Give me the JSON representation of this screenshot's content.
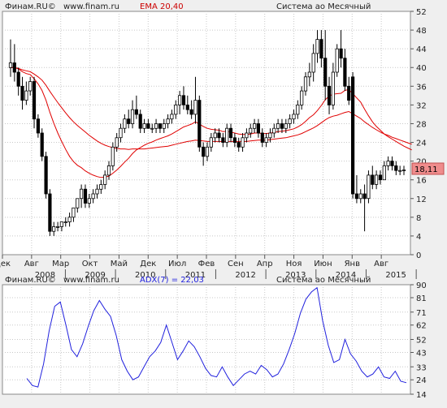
{
  "colors": {
    "page_bg": "#efefef",
    "plot_bg": "#ffffff",
    "grid": "#c8c8c8",
    "up_candle": "#ffffff",
    "down_candle": "#000000",
    "ema": "#e00000",
    "adx": "#2020dd",
    "last_label_bg": "#ef8c8c",
    "header_text": "#222222"
  },
  "header_top": {
    "source": "Финам.RU©",
    "url": "www.finam.ru",
    "indicator": "EMA 20,40",
    "timeframe": "Система ао Месячный"
  },
  "header_bottom": {
    "source": "Финам.RU©",
    "url": "www.finam.ru",
    "indicator": "ADX(7) = 22,03",
    "timeframe": "Система ао Месячный"
  },
  "price_label": "18,11",
  "month_labels": [
    "Дек",
    "Авг",
    "Мар",
    "Окт",
    "Май",
    "Дек",
    "Июл",
    "Фев",
    "Сен",
    "Апр",
    "Ноя",
    "Июн",
    "Янв",
    "Авг"
  ],
  "year_labels": [
    "2008",
    "2009",
    "2010",
    "2011",
    "2012",
    "2013",
    "2014",
    "2015"
  ],
  "chart_data": [
    {
      "type": "candlestick",
      "title": "EMA 20,40",
      "ylim": [
        0,
        52
      ],
      "yticks": [
        0,
        4,
        8,
        12,
        16,
        20,
        24,
        28,
        32,
        36,
        40,
        44,
        48,
        52
      ],
      "x_axis_months": [
        "Дек",
        "Авг",
        "Мар",
        "Окт",
        "Май",
        "Дек",
        "Июл",
        "Фев",
        "Сен",
        "Апр",
        "Ноя",
        "Июн",
        "Янв",
        "Авг"
      ],
      "x_axis_years": [
        "2008",
        "2009",
        "2010",
        "2011",
        "2012",
        "2013",
        "2014",
        "2015"
      ],
      "last_value": 18.11,
      "candles": [
        {
          "o": 40,
          "h": 46,
          "l": 38,
          "c": 41
        },
        {
          "o": 41,
          "h": 45,
          "l": 37,
          "c": 39
        },
        {
          "o": 39,
          "h": 40,
          "l": 34,
          "c": 36
        },
        {
          "o": 36,
          "h": 38,
          "l": 31,
          "c": 33
        },
        {
          "o": 33,
          "h": 37,
          "l": 32,
          "c": 35
        },
        {
          "o": 35,
          "h": 38,
          "l": 34,
          "c": 37
        },
        {
          "o": 37,
          "h": 38,
          "l": 27,
          "c": 29
        },
        {
          "o": 29,
          "h": 30,
          "l": 25,
          "c": 26
        },
        {
          "o": 26,
          "h": 27,
          "l": 20,
          "c": 21
        },
        {
          "o": 21,
          "h": 22,
          "l": 12,
          "c": 13
        },
        {
          "o": 13,
          "h": 14,
          "l": 4,
          "c": 5
        },
        {
          "o": 5,
          "h": 7,
          "l": 4,
          "c": 6
        },
        {
          "o": 6,
          "h": 7,
          "l": 5,
          "c": 6
        },
        {
          "o": 6,
          "h": 7,
          "l": 5,
          "c": 7
        },
        {
          "o": 7,
          "h": 8,
          "l": 6,
          "c": 7
        },
        {
          "o": 7,
          "h": 9,
          "l": 6,
          "c": 8
        },
        {
          "o": 8,
          "h": 10,
          "l": 7,
          "c": 10
        },
        {
          "o": 10,
          "h": 12,
          "l": 9,
          "c": 12
        },
        {
          "o": 12,
          "h": 15,
          "l": 10,
          "c": 14
        },
        {
          "o": 14,
          "h": 15,
          "l": 10,
          "c": 11
        },
        {
          "o": 11,
          "h": 13,
          "l": 10,
          "c": 12
        },
        {
          "o": 12,
          "h": 14,
          "l": 11,
          "c": 13
        },
        {
          "o": 13,
          "h": 15,
          "l": 12,
          "c": 14
        },
        {
          "o": 14,
          "h": 16,
          "l": 13,
          "c": 15
        },
        {
          "o": 15,
          "h": 18,
          "l": 14,
          "c": 17
        },
        {
          "o": 17,
          "h": 20,
          "l": 16,
          "c": 19
        },
        {
          "o": 19,
          "h": 24,
          "l": 18,
          "c": 23
        },
        {
          "o": 23,
          "h": 26,
          "l": 22,
          "c": 25
        },
        {
          "o": 25,
          "h": 28,
          "l": 24,
          "c": 27
        },
        {
          "o": 27,
          "h": 30,
          "l": 26,
          "c": 29
        },
        {
          "o": 29,
          "h": 31,
          "l": 27,
          "c": 28
        },
        {
          "o": 28,
          "h": 33,
          "l": 27,
          "c": 31
        },
        {
          "o": 31,
          "h": 34,
          "l": 29,
          "c": 30
        },
        {
          "o": 30,
          "h": 31,
          "l": 26,
          "c": 27
        },
        {
          "o": 27,
          "h": 29,
          "l": 26,
          "c": 28
        },
        {
          "o": 28,
          "h": 29,
          "l": 27,
          "c": 27
        },
        {
          "o": 27,
          "h": 28,
          "l": 26,
          "c": 27
        },
        {
          "o": 27,
          "h": 29,
          "l": 26,
          "c": 28
        },
        {
          "o": 28,
          "h": 28,
          "l": 26,
          "c": 27
        },
        {
          "o": 27,
          "h": 29,
          "l": 26,
          "c": 28
        },
        {
          "o": 28,
          "h": 30,
          "l": 27,
          "c": 29
        },
        {
          "o": 29,
          "h": 31,
          "l": 28,
          "c": 30
        },
        {
          "o": 30,
          "h": 33,
          "l": 29,
          "c": 32
        },
        {
          "o": 32,
          "h": 35,
          "l": 30,
          "c": 34
        },
        {
          "o": 34,
          "h": 36,
          "l": 31,
          "c": 32
        },
        {
          "o": 32,
          "h": 34,
          "l": 30,
          "c": 31
        },
        {
          "o": 31,
          "h": 33,
          "l": 29,
          "c": 30
        },
        {
          "o": 30,
          "h": 38,
          "l": 28,
          "c": 33
        },
        {
          "o": 33,
          "h": 34,
          "l": 22,
          "c": 23
        },
        {
          "o": 23,
          "h": 24,
          "l": 19,
          "c": 21
        },
        {
          "o": 21,
          "h": 24,
          "l": 20,
          "c": 23
        },
        {
          "o": 23,
          "h": 26,
          "l": 22,
          "c": 25
        },
        {
          "o": 25,
          "h": 27,
          "l": 24,
          "c": 26
        },
        {
          "o": 26,
          "h": 27,
          "l": 24,
          "c": 25
        },
        {
          "o": 25,
          "h": 26,
          "l": 23,
          "c": 24
        },
        {
          "o": 24,
          "h": 28,
          "l": 23,
          "c": 27
        },
        {
          "o": 27,
          "h": 28,
          "l": 24,
          "c": 25
        },
        {
          "o": 25,
          "h": 26,
          "l": 23,
          "c": 24
        },
        {
          "o": 24,
          "h": 25,
          "l": 22,
          "c": 23
        },
        {
          "o": 23,
          "h": 26,
          "l": 22,
          "c": 25
        },
        {
          "o": 25,
          "h": 27,
          "l": 24,
          "c": 26
        },
        {
          "o": 26,
          "h": 28,
          "l": 25,
          "c": 27
        },
        {
          "o": 27,
          "h": 29,
          "l": 26,
          "c": 28
        },
        {
          "o": 28,
          "h": 29,
          "l": 25,
          "c": 26
        },
        {
          "o": 26,
          "h": 27,
          "l": 23,
          "c": 24
        },
        {
          "o": 24,
          "h": 26,
          "l": 23,
          "c": 25
        },
        {
          "o": 25,
          "h": 27,
          "l": 24,
          "c": 26
        },
        {
          "o": 26,
          "h": 28,
          "l": 25,
          "c": 27
        },
        {
          "o": 27,
          "h": 29,
          "l": 26,
          "c": 28
        },
        {
          "o": 28,
          "h": 29,
          "l": 26,
          "c": 27
        },
        {
          "o": 27,
          "h": 29,
          "l": 26,
          "c": 28
        },
        {
          "o": 28,
          "h": 30,
          "l": 27,
          "c": 29
        },
        {
          "o": 29,
          "h": 31,
          "l": 28,
          "c": 30
        },
        {
          "o": 30,
          "h": 33,
          "l": 29,
          "c": 32
        },
        {
          "o": 32,
          "h": 36,
          "l": 31,
          "c": 35
        },
        {
          "o": 35,
          "h": 39,
          "l": 34,
          "c": 38
        },
        {
          "o": 38,
          "h": 41,
          "l": 36,
          "c": 39
        },
        {
          "o": 39,
          "h": 45,
          "l": 37,
          "c": 43
        },
        {
          "o": 43,
          "h": 48,
          "l": 41,
          "c": 46
        },
        {
          "o": 46,
          "h": 48,
          "l": 40,
          "c": 42
        },
        {
          "o": 42,
          "h": 48,
          "l": 33,
          "c": 36
        },
        {
          "o": 36,
          "h": 38,
          "l": 30,
          "c": 32
        },
        {
          "o": 32,
          "h": 41,
          "l": 31,
          "c": 39
        },
        {
          "o": 39,
          "h": 45,
          "l": 38,
          "c": 44
        },
        {
          "o": 44,
          "h": 48,
          "l": 40,
          "c": 42
        },
        {
          "o": 42,
          "h": 44,
          "l": 35,
          "c": 36
        },
        {
          "o": 36,
          "h": 38,
          "l": 32,
          "c": 33
        },
        {
          "o": 38,
          "h": 39,
          "l": 12,
          "c": 13
        },
        {
          "o": 13,
          "h": 17,
          "l": 11,
          "c": 12
        },
        {
          "o": 12,
          "h": 14,
          "l": 11,
          "c": 13
        },
        {
          "o": 13,
          "h": 15,
          "l": 5,
          "c": 12
        },
        {
          "o": 12,
          "h": 18,
          "l": 11,
          "c": 17
        },
        {
          "o": 17,
          "h": 19,
          "l": 14,
          "c": 15
        },
        {
          "o": 15,
          "h": 18,
          "l": 14,
          "c": 17
        },
        {
          "o": 17,
          "h": 18,
          "l": 15,
          "c": 16
        },
        {
          "o": 16,
          "h": 20,
          "l": 16,
          "c": 19
        },
        {
          "o": 19,
          "h": 21,
          "l": 18,
          "c": 20
        },
        {
          "o": 20,
          "h": 21,
          "l": 18,
          "c": 19
        },
        {
          "o": 19,
          "h": 20,
          "l": 17,
          "c": 18
        },
        {
          "o": 18,
          "h": 19,
          "l": 17,
          "c": 18
        },
        {
          "o": 18,
          "h": 19,
          "l": 17,
          "c": 18.11
        }
      ],
      "ema_20": [
        40,
        40,
        39.7,
        39.1,
        38.7,
        38.5,
        37.6,
        36.5,
        35.1,
        33,
        30.4,
        28.1,
        26,
        24.2,
        22.5,
        21,
        19.9,
        19.1,
        18.6,
        17.9,
        17.4,
        17,
        16.7,
        16.5,
        16.6,
        16.8,
        17.4,
        18.1,
        18.9,
        19.8,
        20.6,
        21.6,
        22.4,
        22.9,
        23.4,
        23.8,
        24.1,
        24.5,
        24.8,
        25.1,
        25.4,
        25.8,
        26.3,
        26.8,
        27.3,
        27.6,
        27.9,
        28.4,
        27.9,
        27.4,
        27,
        26.8,
        26.7,
        26.6,
        26.3,
        26.4,
        26.2,
        26,
        25.8,
        25.7,
        25.7,
        25.8,
        26,
        26,
        25.9,
        25.9,
        26,
        26.1,
        26.3,
        26.4,
        26.5,
        26.7,
        26.9,
        27.3,
        27.8,
        28.5,
        29.3,
        29.9,
        30.8,
        31.9,
        33.1,
        33.9,
        34.3,
        34.4,
        34.5,
        35.1,
        35.3,
        34.4,
        33.5,
        32.6,
        31.1,
        29.7,
        28.4,
        27.4,
        26.6,
        25.8,
        25.2,
        24.7,
        24.2,
        23.7,
        23.2,
        22.8,
        22.4
      ],
      "ema_40": [
        40,
        40,
        39.8,
        39.5,
        39.3,
        39.1,
        38.6,
        38,
        37.3,
        36.2,
        34.9,
        33.7,
        32.5,
        31.4,
        30.3,
        29.3,
        28.4,
        27.6,
        26.9,
        26.2,
        25.5,
        24.9,
        24.3,
        23.8,
        23.4,
        23.1,
        22.9,
        22.7,
        22.6,
        22.6,
        22.5,
        22.6,
        22.6,
        22.6,
        22.6,
        22.7,
        22.8,
        22.9,
        23,
        23.1,
        23.2,
        23.4,
        23.6,
        23.8,
        24,
        24.2,
        24.3,
        24.5,
        24.4,
        24.3,
        24.2,
        24.2,
        24.2,
        24.2,
        24.2,
        24.2,
        24.2,
        24.2,
        24.2,
        24.2,
        24.2,
        24.3,
        24.4,
        24.5,
        24.5,
        24.5,
        24.6,
        24.7,
        24.8,
        24.9,
        25,
        25.2,
        25.4,
        25.6,
        25.9,
        26.3,
        26.7,
        27.1,
        27.6,
        28.2,
        28.8,
        29.3,
        29.6,
        29.8,
        30.1,
        30.4,
        30.6,
        30.1,
        29.6,
        29.1,
        28.4,
        27.8,
        27.2,
        26.7,
        26.2,
        25.8,
        25.5,
        25.1,
        24.8,
        24.5,
        24.2,
        23.9,
        23.6
      ]
    },
    {
      "type": "line",
      "title": "ADX(7) = 22,03",
      "ylim": [
        14,
        90
      ],
      "yticks": [
        14,
        24,
        33,
        43,
        52,
        62,
        71,
        81,
        90
      ],
      "last_value": 22.03,
      "series": [
        {
          "name": "ADX(7)",
          "values": [
            25,
            20,
            19,
            35,
            58,
            75,
            78,
            62,
            45,
            40,
            49,
            61,
            72,
            79,
            73,
            68,
            55,
            38,
            30,
            24,
            26,
            33,
            40,
            44,
            50,
            62,
            50,
            38,
            44,
            51,
            47,
            40,
            32,
            27,
            26,
            33,
            26,
            20,
            24,
            28,
            30,
            28,
            34,
            31,
            26,
            28,
            35,
            45,
            56,
            70,
            80,
            85,
            88,
            65,
            48,
            36,
            38,
            52,
            42,
            37,
            30,
            26,
            28,
            33,
            26,
            25,
            30,
            23,
            22
          ]
        }
      ]
    }
  ]
}
